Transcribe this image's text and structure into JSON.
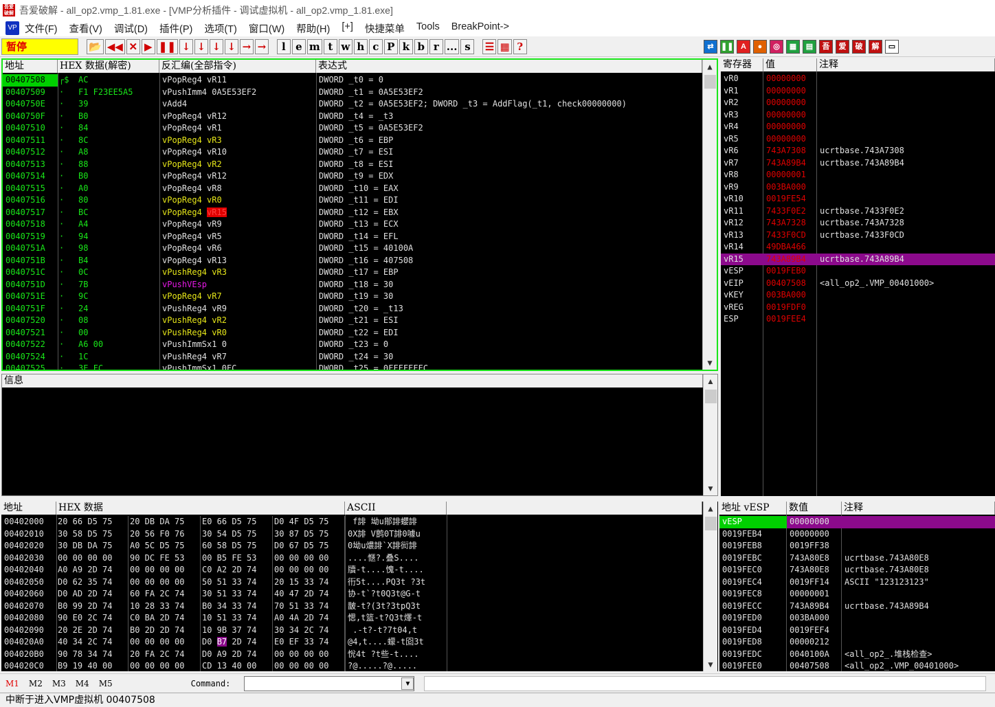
{
  "window": {
    "title": "吾爱破解 - all_op2.vmp_1.81.exe - [VMP分析插件 - 调试虚拟机 - all_op2.vmp_1.81.exe]",
    "app_icon_text": "吾爱破解"
  },
  "menu": {
    "logo": "VP",
    "items": [
      "文件(F)",
      "查看(V)",
      "调试(D)",
      "插件(P)",
      "选项(T)",
      "窗口(W)",
      "帮助(H)",
      "[+]",
      "快捷菜单",
      "Tools",
      "BreakPoint->"
    ]
  },
  "toolbar": {
    "status": "暂停",
    "nav_buttons": [
      "📂",
      "◀◀",
      "✕",
      "▶",
      "❚❚",
      "↓",
      "↓",
      "↓",
      "↓",
      "→",
      "→"
    ],
    "letter_buttons": [
      "l",
      "e",
      "m",
      "t",
      "w",
      "h",
      "c",
      "P",
      "k",
      "b",
      "r",
      "...",
      "s"
    ],
    "extra_buttons": [
      "☰",
      "▦",
      "?"
    ],
    "plugin_buttons": [
      "⇄",
      "❚❚",
      "A",
      "●",
      "◎",
      "▦",
      "▤",
      "吾",
      "爱",
      "破",
      "解",
      "▭"
    ]
  },
  "cpu": {
    "headers": [
      "地址",
      "HEX 数据(解密)",
      "反汇编(全部指令)",
      "表达式"
    ],
    "rows": [
      {
        "addr": "00407508",
        "mark": "┌$",
        "hex": "AC",
        "dis": "vPopReg4 vR11",
        "expr": "DWORD _t0 = 0",
        "sel": true,
        "dis_color": "w",
        "hex_color": "g"
      },
      {
        "addr": "00407509",
        "mark": "·",
        "hex": "F1 F23EE5A5",
        "dis": "vPushImm4 0A5E53EF2",
        "expr": "DWORD _t1 = 0A5E53EF2",
        "dis_color": "w",
        "hex_color": "g"
      },
      {
        "addr": "0040750E",
        "mark": "·",
        "hex": "39",
        "dis": "vAdd4",
        "expr": "DWORD _t2 = 0A5E53EF2; DWORD _t3 = AddFlag(_t1, check00000000)",
        "dis_color": "w",
        "hex_color": "g"
      },
      {
        "addr": "0040750F",
        "mark": "·",
        "hex": "B0",
        "dis": "vPopReg4 vR12",
        "expr": "DWORD _t4 = _t3",
        "dis_color": "w",
        "hex_color": "g"
      },
      {
        "addr": "00407510",
        "mark": "·",
        "hex": "84",
        "dis": "vPopReg4 vR1",
        "expr": "DWORD _t5 = 0A5E53EF2",
        "dis_color": "w",
        "hex_color": "g"
      },
      {
        "addr": "00407511",
        "mark": "·",
        "hex": "8C",
        "dis": "vPopReg4 vR3",
        "expr": "DWORD _t6 = EBP",
        "dis_color": "y",
        "hex_color": "g"
      },
      {
        "addr": "00407512",
        "mark": "·",
        "hex": "A8",
        "dis": "vPopReg4 vR10",
        "expr": "DWORD _t7 = ESI",
        "dis_color": "w",
        "hex_color": "g"
      },
      {
        "addr": "00407513",
        "mark": "·",
        "hex": "88",
        "dis": "vPopReg4 vR2",
        "expr": "DWORD _t8 = ESI",
        "dis_color": "y",
        "hex_color": "g"
      },
      {
        "addr": "00407514",
        "mark": "·",
        "hex": "B0",
        "dis": "vPopReg4 vR12",
        "expr": "DWORD _t9 = EDX",
        "dis_color": "w",
        "hex_color": "g"
      },
      {
        "addr": "00407515",
        "mark": "·",
        "hex": "A0",
        "dis": "vPopReg4 vR8",
        "expr": "DWORD _t10 = EAX",
        "dis_color": "w",
        "hex_color": "g"
      },
      {
        "addr": "00407516",
        "mark": "·",
        "hex": "80",
        "dis": "vPopReg4 vR0",
        "expr": "DWORD _t11 = EDI",
        "dis_color": "y",
        "hex_color": "g"
      },
      {
        "addr": "00407517",
        "mark": "·",
        "hex": "BC",
        "dis": "vPopReg4 vR15",
        "expr": "DWORD _t12 = EBX",
        "dis_color": "y",
        "hex_color": "g",
        "redreg": true
      },
      {
        "addr": "00407518",
        "mark": "·",
        "hex": "A4",
        "dis": "vPopReg4 vR9",
        "expr": "DWORD _t13 = ECX",
        "dis_color": "w",
        "hex_color": "g"
      },
      {
        "addr": "00407519",
        "mark": "·",
        "hex": "94",
        "dis": "vPopReg4 vR5",
        "expr": "DWORD _t14 = EFL",
        "dis_color": "w",
        "hex_color": "g"
      },
      {
        "addr": "0040751A",
        "mark": "·",
        "hex": "98",
        "dis": "vPopReg4 vR6",
        "expr": "DWORD _t15 = 40100A",
        "dis_color": "w",
        "hex_color": "g"
      },
      {
        "addr": "0040751B",
        "mark": "·",
        "hex": "B4",
        "dis": "vPopReg4 vR13",
        "expr": "DWORD _t16 = 407508",
        "dis_color": "w",
        "hex_color": "g"
      },
      {
        "addr": "0040751C",
        "mark": "·",
        "hex": "0C",
        "dis": "vPushReg4 vR3",
        "expr": "DWORD _t17 = EBP",
        "dis_color": "y",
        "hex_color": "g"
      },
      {
        "addr": "0040751D",
        "mark": "·",
        "hex": "7B",
        "dis": "vPushVEsp",
        "expr": "DWORD _t18 = 30",
        "dis_color": "m",
        "hex_color": "g"
      },
      {
        "addr": "0040751E",
        "mark": "·",
        "hex": "9C",
        "dis": "vPopReg4 vR7",
        "expr": "DWORD _t19 = 30",
        "dis_color": "y",
        "hex_color": "g"
      },
      {
        "addr": "0040751F",
        "mark": "·",
        "hex": "24",
        "dis": "vPushReg4 vR9",
        "expr": "DWORD _t20 = _t13",
        "dis_color": "w",
        "hex_color": "g"
      },
      {
        "addr": "00407520",
        "mark": "·",
        "hex": "08",
        "dis": "vPushReg4 vR2",
        "expr": "DWORD _t21 = ESI",
        "dis_color": "y",
        "hex_color": "g"
      },
      {
        "addr": "00407521",
        "mark": "·",
        "hex": "00",
        "dis": "vPushReg4 vR0",
        "expr": "DWORD _t22 = EDI",
        "dis_color": "y",
        "hex_color": "g"
      },
      {
        "addr": "00407522",
        "mark": "·",
        "hex": "A6 00",
        "dis": "vPushImmSx1 0",
        "expr": "DWORD _t23 = 0",
        "dis_color": "w",
        "hex_color": "g"
      },
      {
        "addr": "00407524",
        "mark": "·",
        "hex": "1C",
        "dis": "vPushReg4 vR7",
        "expr": "DWORD _t24 = 30",
        "dis_color": "w",
        "hex_color": "g"
      },
      {
        "addr": "00407525",
        "mark": "·",
        "hex": "3E FC",
        "dis": "vPushImmSx1 0FC",
        "expr": "DWORD _t25 = 0FFFFFFFC",
        "dis_color": "w",
        "hex_color": "g"
      }
    ]
  },
  "info": {
    "header": "信息"
  },
  "regs": {
    "headers": [
      "寄存器",
      "值",
      "注释"
    ],
    "rows": [
      {
        "name": "vR0",
        "val": "00000000",
        "note": ""
      },
      {
        "name": "vR1",
        "val": "00000000",
        "note": ""
      },
      {
        "name": "vR2",
        "val": "00000000",
        "note": ""
      },
      {
        "name": "vR3",
        "val": "00000000",
        "note": ""
      },
      {
        "name": "vR4",
        "val": "00000000",
        "note": ""
      },
      {
        "name": "vR5",
        "val": "00000000",
        "note": ""
      },
      {
        "name": "vR6",
        "val": "743A7308",
        "note": "ucrtbase.743A7308"
      },
      {
        "name": "vR7",
        "val": "743A89B4",
        "note": "ucrtbase.743A89B4"
      },
      {
        "name": "vR8",
        "val": "00000001",
        "note": ""
      },
      {
        "name": "vR9",
        "val": "003BA000",
        "note": ""
      },
      {
        "name": "vR10",
        "val": "0019FE54",
        "note": ""
      },
      {
        "name": "vR11",
        "val": "7433F0E2",
        "note": "ucrtbase.7433F0E2"
      },
      {
        "name": "vR12",
        "val": "743A7328",
        "note": "ucrtbase.743A7328"
      },
      {
        "name": "vR13",
        "val": "7433F0CD",
        "note": "ucrtbase.7433F0CD"
      },
      {
        "name": "vR14",
        "val": "49DBA466",
        "note": ""
      },
      {
        "name": "vR15",
        "val": "743A89B4",
        "note": "ucrtbase.743A89B4",
        "sel": true
      },
      {
        "name": "vESP",
        "val": "0019FEB0",
        "note": ""
      },
      {
        "name": "vEIP",
        "val": "00407508",
        "note": "<all_op2_.VMP_00401000>"
      },
      {
        "name": "vKEY",
        "val": "003BA000",
        "note": ""
      },
      {
        "name": "vREG",
        "val": "0019FDF0",
        "note": ""
      },
      {
        "name": "ESP",
        "val": "0019FEE4",
        "note": ""
      }
    ]
  },
  "dump": {
    "headers": [
      "地址",
      "HEX 数据",
      "ASCII"
    ],
    "rows": [
      {
        "addr": "00402000",
        "hex": [
          "20 66 D5 75",
          "20 DB DA 75",
          "E0 66 D5 75",
          "D0 4F D5 75"
        ],
        "ascii": " f誹 坳u鄁誹蠳誹"
      },
      {
        "addr": "00402010",
        "hex": [
          "30 58 D5 75",
          "20 56 F0 76",
          "30 54 D5 75",
          "30 87 D5 75"
        ],
        "ascii": "0X誹 V鹯0T誹0噱u"
      },
      {
        "addr": "00402020",
        "hex": [
          "30 DB DA 75",
          "A0 5C D5 75",
          "60 58 D5 75",
          "D0 67 D5 75"
        ],
        "ascii": "0坳u燶誹`X誹衏誹"
      },
      {
        "addr": "00402030",
        "hex": [
          "00 00 00 00",
          "90 DC FE 53",
          "00 B5 FE 53",
          "00 00 00 00"
        ],
        "ascii": "....愜?.叠S...."
      },
      {
        "addr": "00402040",
        "hex": [
          "A0 A9 2D 74",
          "00 00 00 00",
          "C0 A2 2D 74",
          "00 00 00 00"
        ],
        "ascii": "牘-t....愧-t...."
      },
      {
        "addr": "00402050",
        "hex": [
          "D0 62 35 74",
          "00 00 00 00",
          "50 51 33 74",
          "20 15 33 74"
        ],
        "ascii": "衎5t....PQ3t ?3t"
      },
      {
        "addr": "00402060",
        "hex": [
          "D0 AD 2D 74",
          "60 FA 2C 74",
          "30 51 33 74",
          "40 47 2D 74"
        ],
        "ascii": "协-t`?t0Q3t@G-t"
      },
      {
        "addr": "00402070",
        "hex": [
          "B0 99 2D 74",
          "10 28 33 74",
          "B0 34 33 74",
          "70 51 33 74"
        ],
        "ascii": "皵-t?(3t?3tpQ3t"
      },
      {
        "addr": "00402080",
        "hex": [
          "90 E0 2C 74",
          "C0 BA 2D 74",
          "10 51 33 74",
          "A0 4A 2D 74"
        ],
        "ascii": "愢,t篮-t?Q3t燡-t"
      },
      {
        "addr": "00402090",
        "hex": [
          "20 2E 2D 74",
          "B0 2D 2D 74",
          "10 9B 37 74",
          "30 34 2C 74"
        ],
        "ascii": " .-t?-t?7t04,t"
      },
      {
        "addr": "004020A0",
        "hex": [
          "40 34 2C 74",
          "00 00 00 00",
          "D0 B7 2D 74",
          "E0 EF 33 74"
        ],
        "ascii": "@4,t....蠓-t囵3t",
        "hl": true
      },
      {
        "addr": "004020B0",
        "hex": [
          "90 78 34 74",
          "20 FA 2C 74",
          "D0 A9 2D 74",
          "00 00 00 00"
        ],
        "ascii": "恱4t ?t些-t...."
      },
      {
        "addr": "004020C0",
        "hex": [
          "B9 19 40 00",
          "00 00 00 00",
          "CD 13 40 00",
          "00 00 00 00"
        ],
        "ascii": "?@.....?@....."
      }
    ]
  },
  "stack": {
    "headers": [
      "地址 vESP",
      "数值",
      "注释"
    ],
    "rows": [
      {
        "addr": "vESP",
        "val": "00000000",
        "note": "",
        "sel": true
      },
      {
        "addr": "0019FEB4",
        "val": "00000000",
        "note": ""
      },
      {
        "addr": "0019FEB8",
        "val": "0019FF38",
        "note": ""
      },
      {
        "addr": "0019FEBC",
        "val": "743A80E8",
        "note": "ucrtbase.743A80E8"
      },
      {
        "addr": "0019FEC0",
        "val": "743A80E8",
        "note": "ucrtbase.743A80E8"
      },
      {
        "addr": "0019FEC4",
        "val": "0019FF14",
        "note": "ASCII \"123123123\""
      },
      {
        "addr": "0019FEC8",
        "val": "00000001",
        "note": ""
      },
      {
        "addr": "0019FECC",
        "val": "743A89B4",
        "note": "ucrtbase.743A89B4"
      },
      {
        "addr": "0019FED0",
        "val": "003BA000",
        "note": ""
      },
      {
        "addr": "0019FED4",
        "val": "0019FEF4",
        "note": ""
      },
      {
        "addr": "0019FED8",
        "val": "00000212",
        "note": ""
      },
      {
        "addr": "0019FEDC",
        "val": "0040100A",
        "note": "<all_op2_.堆栈检查>"
      },
      {
        "addr": "0019FEE0",
        "val": "00407508",
        "note": "<all_op2_.VMP_00401000>"
      }
    ]
  },
  "cmdbar": {
    "marks": [
      "M1",
      "M2",
      "M3",
      "M4",
      "M5"
    ],
    "command_label": "Command:",
    "command_value": ""
  },
  "status": {
    "text": "中断于进入VMP虚拟机 00407508"
  },
  "colors": {
    "green": "#19e619",
    "yellow": "#e6e619",
    "magenta": "#e619e6",
    "red": "#e00000",
    "selection_purple": "#8c0a8c"
  }
}
